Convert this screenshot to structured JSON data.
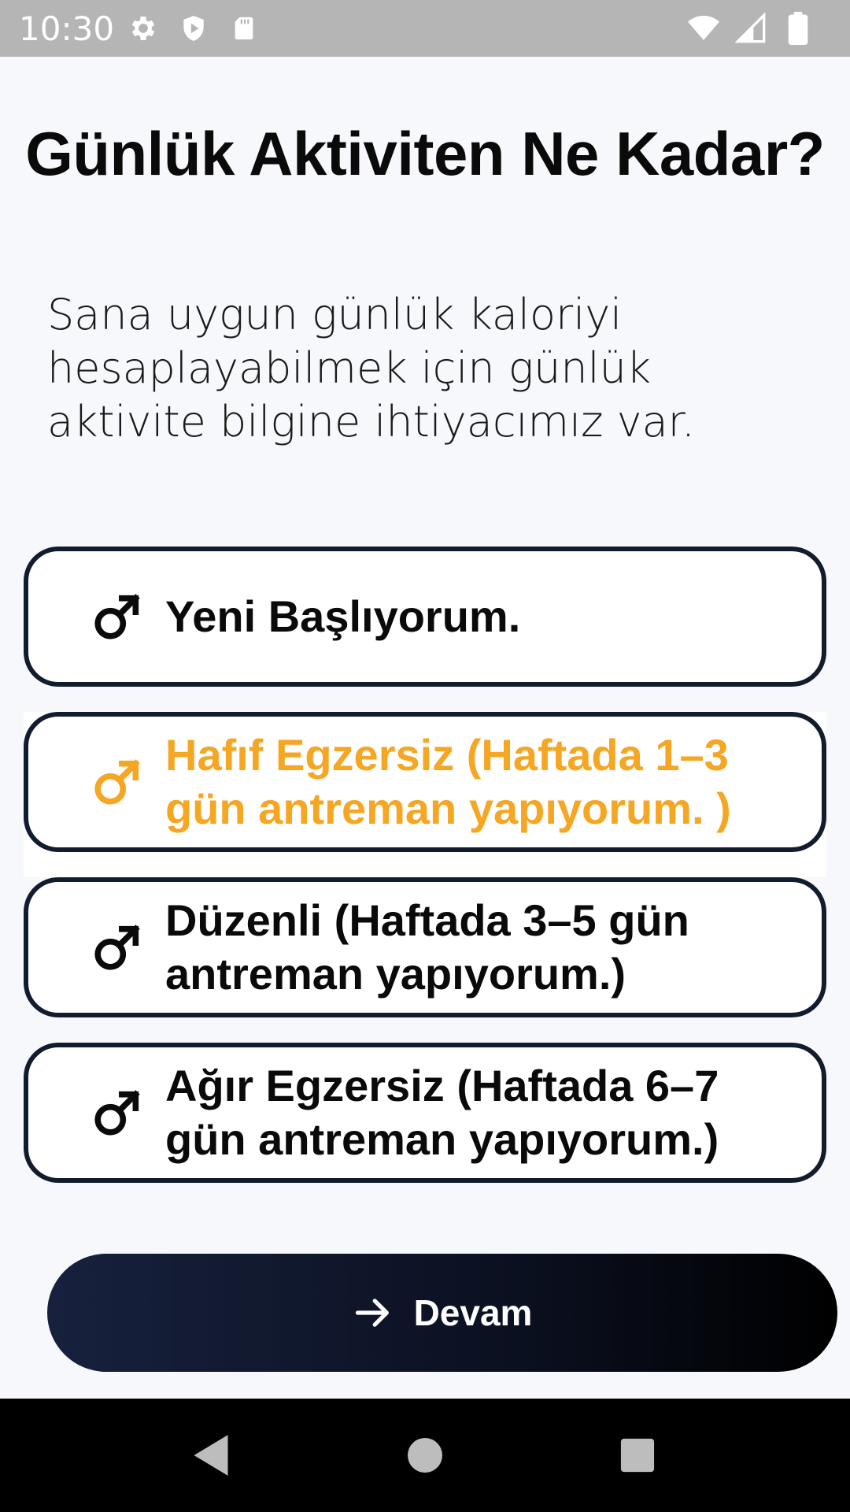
{
  "status_bar": {
    "time": "10:30",
    "left_icons": [
      "gear-icon",
      "shield-icon",
      "sd-card-icon"
    ],
    "right_icons": [
      "wifi-icon",
      "signal-icon",
      "battery-icon"
    ]
  },
  "title": "Günlük Aktiviten Ne Kadar?",
  "description": "Sana uygun günlük kaloriyi hesaplayabilmek için günlük aktivite bilgine ihtiyacımız var.",
  "options": [
    {
      "label": "Yeni Başlıyorum.",
      "icon": "male-symbol-icon",
      "selected": false
    },
    {
      "label": "Hafıf Egzersiz (Haftada 1–3 gün antreman yapıyorum. )",
      "icon": "male-symbol-icon",
      "selected": true
    },
    {
      "label": "Düzenli (Haftada 3–5 gün antreman yapıyorum.)",
      "icon": "male-symbol-icon",
      "selected": false
    },
    {
      "label": "Ağır Egzersiz (Haftada 6–7 gün antreman yapıyorum.)",
      "icon": "male-symbol-icon",
      "selected": false
    }
  ],
  "continue_button": {
    "label": "Devam",
    "icon": "arrow-right-icon"
  },
  "colors": {
    "selected_accent": "#f5a623",
    "border": "#131c2e",
    "button_gradient_start": "#17213d",
    "button_gradient_end": "#000000"
  },
  "nav_bar": {
    "buttons": [
      "back-icon",
      "home-icon",
      "recents-icon"
    ]
  }
}
